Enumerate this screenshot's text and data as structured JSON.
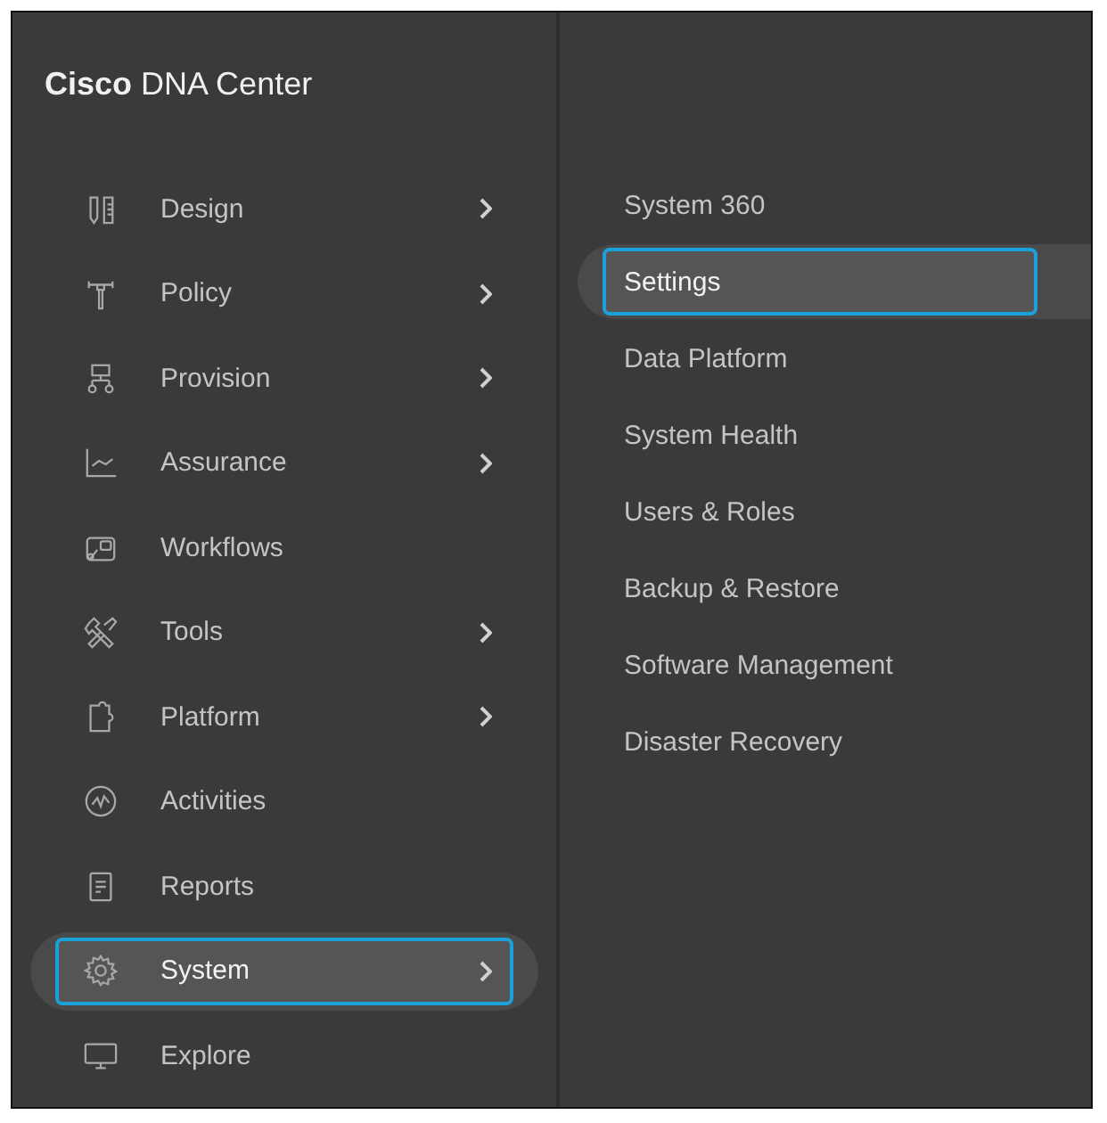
{
  "title": {
    "brand": "Cisco",
    "product": "DNA Center"
  },
  "nav": [
    {
      "label": "Design",
      "submenu": true,
      "selected": false
    },
    {
      "label": "Policy",
      "submenu": true,
      "selected": false
    },
    {
      "label": "Provision",
      "submenu": true,
      "selected": false
    },
    {
      "label": "Assurance",
      "submenu": true,
      "selected": false
    },
    {
      "label": "Workflows",
      "submenu": false,
      "selected": false
    },
    {
      "label": "Tools",
      "submenu": true,
      "selected": false
    },
    {
      "label": "Platform",
      "submenu": true,
      "selected": false
    },
    {
      "label": "Activities",
      "submenu": false,
      "selected": false
    },
    {
      "label": "Reports",
      "submenu": false,
      "selected": false
    },
    {
      "label": "System",
      "submenu": true,
      "selected": true
    },
    {
      "label": "Explore",
      "submenu": false,
      "selected": false
    }
  ],
  "submenu": [
    {
      "label": "System 360",
      "selected": false
    },
    {
      "label": "Settings",
      "selected": true
    },
    {
      "label": "Data Platform",
      "selected": false
    },
    {
      "label": "System Health",
      "selected": false
    },
    {
      "label": "Users & Roles",
      "selected": false
    },
    {
      "label": "Backup & Restore",
      "selected": false
    },
    {
      "label": "Software Management",
      "selected": false
    },
    {
      "label": "Disaster Recovery",
      "selected": false
    }
  ]
}
